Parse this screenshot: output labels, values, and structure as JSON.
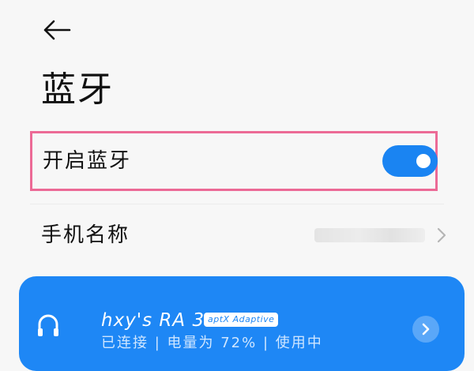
{
  "header": {
    "title": "蓝牙"
  },
  "bluetooth_toggle": {
    "label": "开启蓝牙",
    "enabled": true
  },
  "device_name_row": {
    "label": "手机名称"
  },
  "connected_device": {
    "name": "hxy's RA 3",
    "codec": "aptX Adaptive",
    "status": "已连接 | 电量为 72% | 使用中"
  },
  "colors": {
    "accent": "#1a84f2",
    "highlight_border": "#ec6a96"
  }
}
